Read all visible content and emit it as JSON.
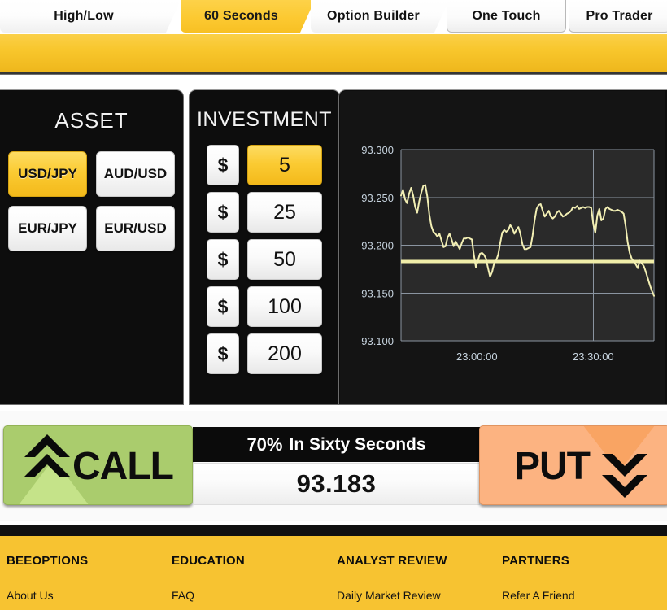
{
  "tabs": [
    {
      "label": "High/Low",
      "active": false,
      "shape": "slant"
    },
    {
      "label": "60 Seconds",
      "active": true,
      "shape": "slant"
    },
    {
      "label": "Option Builder",
      "active": false,
      "shape": "slant"
    },
    {
      "label": "One Touch",
      "active": false,
      "shape": "plain"
    },
    {
      "label": "Pro Trader",
      "active": false,
      "shape": "plain"
    }
  ],
  "asset_panel": {
    "title": "ASSET",
    "options": [
      {
        "label": "USD/JPY",
        "selected": true
      },
      {
        "label": "AUD/USD",
        "selected": false
      },
      {
        "label": "EUR/JPY",
        "selected": false
      },
      {
        "label": "EUR/USD",
        "selected": false
      }
    ]
  },
  "investment_panel": {
    "title": "INVESTMENT",
    "currency_symbol": "$",
    "options": [
      {
        "amount": "5",
        "selected": true
      },
      {
        "amount": "25",
        "selected": false
      },
      {
        "amount": "50",
        "selected": false
      },
      {
        "amount": "100",
        "selected": false
      },
      {
        "amount": "200",
        "selected": false
      }
    ]
  },
  "trade_bar": {
    "call_label": "CALL",
    "put_label": "PUT",
    "payout_percent": "70%",
    "payout_text": "In Sixty Seconds",
    "current_price": "93.183",
    "call_color": "#aacc6d",
    "put_color": "#fcb381"
  },
  "footer": {
    "columns": [
      {
        "heading": "BEEOPTIONS",
        "link": "About Us"
      },
      {
        "heading": "EDUCATION",
        "link": "FAQ"
      },
      {
        "heading": "ANALYST REVIEW",
        "link": "Daily Market Review"
      },
      {
        "heading": "PARTNERS",
        "link": "Refer A Friend"
      }
    ]
  },
  "chart_data": {
    "type": "line",
    "title": "",
    "xlabel": "",
    "ylabel": "",
    "ylim": [
      93.1,
      93.3
    ],
    "yticks": [
      93.3,
      93.25,
      93.2,
      93.15,
      93.1
    ],
    "ytick_labels": [
      "93.300",
      "93.250",
      "93.200",
      "93.150",
      "93.100"
    ],
    "xticks": [
      "23:00:00",
      "23:30:00"
    ],
    "xtick_labels": [
      "23:00:00",
      "23:30:00"
    ],
    "grid": true,
    "line_color": "#f2efb4",
    "grid_color": "#8a94a0",
    "background": "#2a2a2a",
    "strike_line": {
      "value": 93.183,
      "color": "#f0eda8",
      "label": "93.183"
    },
    "series": [
      {
        "name": "USD/JPY",
        "values": [
          93.252,
          93.258,
          93.248,
          93.244,
          93.254,
          93.26,
          93.252,
          93.24,
          93.234,
          93.246,
          93.255,
          93.262,
          93.263,
          93.251,
          93.232,
          93.22,
          93.214,
          93.212,
          93.209,
          93.212,
          93.205,
          93.198,
          93.199,
          93.208,
          93.212,
          93.206,
          93.199,
          93.204,
          93.2,
          93.196,
          93.202,
          93.207,
          93.207,
          93.208,
          93.207,
          93.206,
          93.19,
          93.177,
          93.184,
          93.191,
          93.192,
          93.19,
          93.186,
          93.176,
          93.167,
          93.172,
          93.181,
          93.184,
          93.19,
          93.202,
          93.213,
          93.216,
          93.214,
          93.216,
          93.221,
          93.218,
          93.212,
          93.216,
          93.219,
          93.212,
          93.201,
          93.196,
          93.196,
          93.197,
          93.198,
          93.21,
          93.226,
          93.238,
          93.242,
          93.243,
          93.236,
          93.23,
          93.233,
          93.236,
          93.23,
          93.228,
          93.23,
          93.234,
          93.236,
          93.233,
          93.23,
          93.231,
          93.233,
          93.234,
          93.236,
          93.24,
          93.239,
          93.241,
          93.238,
          93.239,
          93.24,
          93.239,
          93.24,
          93.24,
          93.239,
          93.222,
          93.213,
          93.231,
          93.238,
          93.226,
          93.228,
          93.238,
          93.24,
          93.238,
          93.237,
          93.236,
          93.236,
          93.237,
          93.236,
          93.235,
          93.233,
          93.22,
          93.203,
          93.192,
          93.186,
          93.183,
          93.18,
          93.176,
          93.184,
          93.181,
          93.178,
          93.172,
          93.165,
          93.158,
          93.152,
          93.147
        ]
      }
    ]
  }
}
